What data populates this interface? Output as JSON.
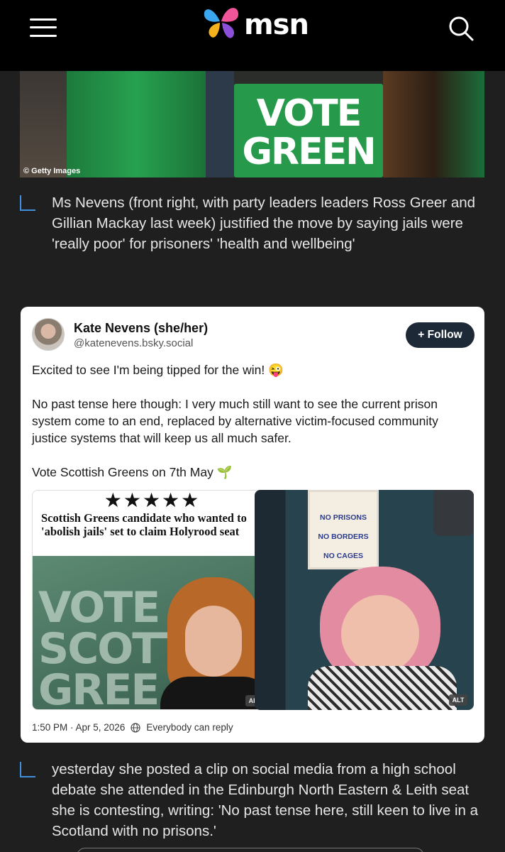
{
  "header": {
    "logo_text": "msn",
    "menu_icon": "hamburger-menu-icon",
    "search_icon": "search-icon"
  },
  "hero": {
    "sign_line1": "VOTE",
    "sign_line2": "GREEN",
    "credit": "© Getty Images"
  },
  "captions": [
    "Ms Nevens (front right, with party leaders leaders Ross Greer and Gillian Mackay last week) justified the move by saying jails were 'really poor' for prisoners' 'health and wellbeing'",
    "yesterday she posted a clip on social media from a high school debate she attended in the Edinburgh North Eastern & Leith seat she is contesting, writing: 'No past tense here, still keen to live in a Scotland with no prisons.'"
  ],
  "post": {
    "author_name": "Kate Nevens (she/her)",
    "author_handle": "@katenevens.bsky.social",
    "follow_label": "+ Follow",
    "paragraphs": [
      "Excited to see I'm being tipped for the win! 😜",
      "No past tense here though: I very much still want to see the current prison system come to an end, replaced by alternative victim-focused community justice systems that will keep us all much safer.",
      "Vote Scottish Greens on 7th May 🌱"
    ],
    "image_left": {
      "stars": "★★★★★",
      "headline": "Scottish Greens candidate who wanted to 'abolish jails' set to claim Holyrood seat",
      "bg_text": [
        "VOTE",
        "SCOTT",
        "GREE"
      ],
      "alt": "ALT"
    },
    "image_right": {
      "poster_lines": [
        "NO PRISONS",
        "NO BORDERS",
        "NO CAGES"
      ],
      "alt": "ALT"
    },
    "timestamp": "1:50 PM · Apr 5, 2026",
    "reply_setting": "Everybody can reply"
  },
  "colors": {
    "accent_corner": "#3e8fe0",
    "follow_bg": "#1e2937",
    "page_bg": "#1f1f1f"
  }
}
